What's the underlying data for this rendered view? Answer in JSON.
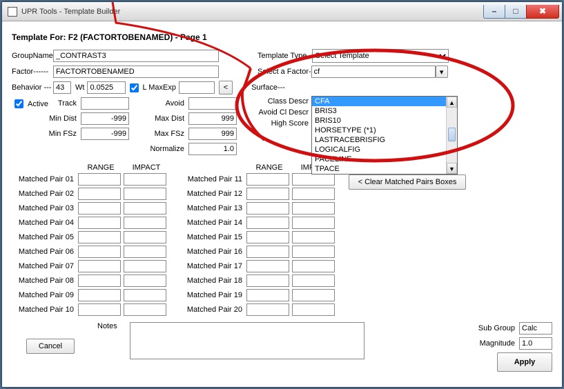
{
  "window": {
    "title": "UPR Tools - Template Builder"
  },
  "page": {
    "heading": "Template For: F2 (FACTORTOBENAMED) - Page 1"
  },
  "labels": {
    "groupName": "GroupName",
    "factor": "Factor------",
    "behavior": "Behavior ---",
    "wt": "Wt",
    "maxExp": "L  MaxExp",
    "active": "Active",
    "track": "Track",
    "avoid": "Avoid",
    "minDist": "Min Dist",
    "maxDist": "Max Dist",
    "minFSz": "Min FSz",
    "maxFSz": "Max FSz",
    "normalize": "Normalize",
    "templateType": "Template Type--",
    "selectFactor": "Select a Factor-",
    "surface": "Surface---",
    "classDescr": "Class Descr",
    "avoidClDescr": "Avoid Cl Descr",
    "highScore": "High Score",
    "range": "RANGE",
    "impact": "IMPACT",
    "notes": "Notes",
    "subGroup": "Sub Group",
    "magnitude": "Magnitude",
    "cancel": "Cancel",
    "apply": "Apply",
    "clearPairs": "< Clear Matched Pairs Boxes",
    "ltButton": "<"
  },
  "fields": {
    "groupName": "_CONTRAST3",
    "factor": "FACTORTOBENAMED",
    "behavior": "43",
    "wt": "0.0525",
    "lChecked": true,
    "maxExp": "",
    "active": true,
    "track": "",
    "avoid": "",
    "minDist": "-999",
    "maxDist": "999",
    "minFSz": "-999",
    "maxFSz": "999",
    "normalize": "1.0",
    "templateType": "Select Template",
    "selectFactor": "cf",
    "subGroup": "Calc",
    "magnitude": "1.0",
    "notes": ""
  },
  "factorList": {
    "selectedIndex": 0,
    "items": [
      "CFA",
      "BRIS3",
      "BRIS10",
      "HORSETYPE  (*1)",
      "LASTRACEBRISFIG",
      "LOGICALFIG",
      "PACELINE",
      "TPACE"
    ]
  },
  "pairs": {
    "left": [
      "Matched Pair 01",
      "Matched Pair 02",
      "Matched Pair 03",
      "Matched Pair 04",
      "Matched Pair 05",
      "Matched Pair 06",
      "Matched Pair 07",
      "Matched Pair 08",
      "Matched Pair 09",
      "Matched Pair 10"
    ],
    "right": [
      "Matched Pair 11",
      "Matched Pair 12",
      "Matched Pair 13",
      "Matched Pair 14",
      "Matched Pair 15",
      "Matched Pair 16",
      "Matched Pair 17",
      "Matched Pair 18",
      "Matched Pair 19",
      "Matched Pair 20"
    ]
  }
}
